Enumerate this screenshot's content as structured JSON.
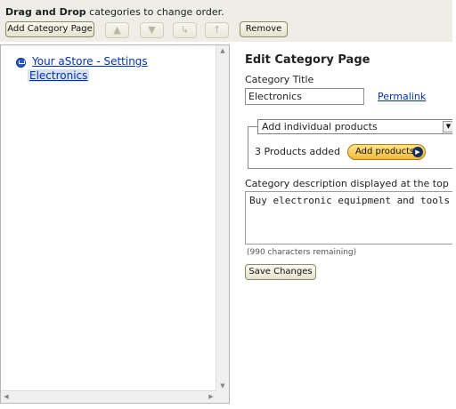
{
  "toolbar": {
    "hint_bold": "Drag and Drop",
    "hint_rest": " categories to change order.",
    "add_category_label": "Add Category Page",
    "remove_label": "Remove",
    "icons": [
      "up-arrow-icon",
      "down-arrow-icon",
      "indent-icon",
      "outdent-icon"
    ]
  },
  "tree": {
    "root_label": "Your aStore - Settings",
    "child_label": "Electronics"
  },
  "edit": {
    "heading": "Edit Category Page",
    "category_title_label": "Category Title",
    "category_title_value": "Electronics",
    "permalink_label": "Permalink",
    "select_value": "Add individual products",
    "products_added": "3 Products added",
    "add_products_label": "Add products",
    "description_label": "Category description displayed at the top",
    "description_value": "Buy electronic equipment and tools",
    "chars_remaining": "(990 characters remaining)",
    "save_label": "Save Changes"
  },
  "colors": {
    "toolbar_bg": "#eeeee6",
    "link": "#0033aa",
    "selected_bg": "#d8e1f2",
    "add_products_bg": "#f3b73a"
  }
}
